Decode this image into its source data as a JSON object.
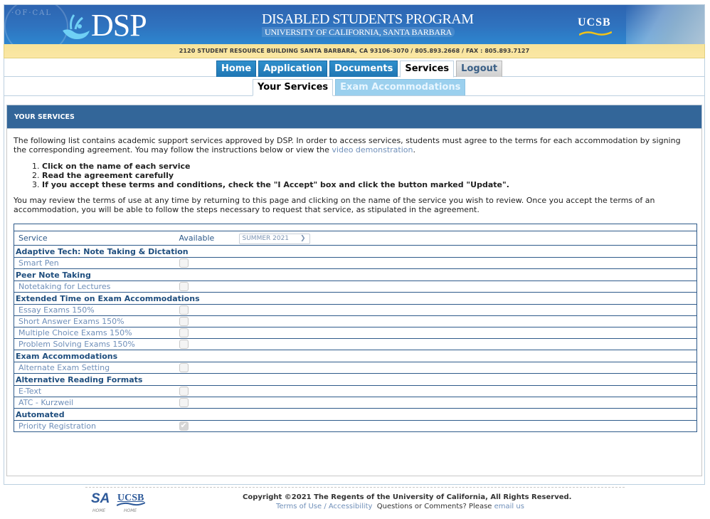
{
  "header": {
    "seal_text": "·OF·CAL",
    "logo": "DSP",
    "program_title": "DISABLED STUDENTS PROGRAM",
    "program_subtitle": "UNIVERSITY OF CALIFORNIA, SANTA BARBARA",
    "ucsb_logo": "UCSB",
    "address": "2120 STUDENT RESOURCE BUILDING SANTA BARBARA, CA 93106-3070 / 805.893.2668 / FAX : 805.893.7127",
    "brand_color": "#2f6fba",
    "address_bar_color": "#fbe7a4"
  },
  "nav": {
    "tabs": [
      {
        "label": "Home",
        "active": false
      },
      {
        "label": "Application",
        "active": false
      },
      {
        "label": "Documents",
        "active": false
      },
      {
        "label": "Services",
        "active": true
      },
      {
        "label": "Logout",
        "active": false
      }
    ]
  },
  "subnav": {
    "tabs": [
      {
        "label": "Your Services",
        "active": true
      },
      {
        "label": "Exam Accommodations",
        "active": false
      }
    ]
  },
  "section": {
    "title": "YOUR SERVICES",
    "header_color": "#336699",
    "intro_part1": "The following list contains academic support services approved by DSP. In order to access services, students must agree to the terms for each accommodation by signing the corresponding agreement. You may follow the instructions below or view the ",
    "intro_link": "video demonstration",
    "intro_part2": ".",
    "steps": [
      "Click on the name of each service",
      "Read the agreement carefully",
      "If you accept these terms and conditions, check the \"I Accept\" box and click the button marked \"Update\"."
    ],
    "review_text": "You may review the terms of use at any time by returning to this page and clicking on the name of the service you wish to review. Once you accept the terms of an accommodation, you will be able to follow the steps necessary to request that service, as stipulated in the agreement."
  },
  "table": {
    "col_service": "Service",
    "col_available": "Available",
    "term_select": "SUMMER 2021",
    "categories": [
      {
        "name": "Adaptive Tech: Note Taking & Dictation",
        "services": [
          {
            "name": "Smart Pen",
            "checked": false
          }
        ]
      },
      {
        "name": "Peer Note Taking",
        "services": [
          {
            "name": "Notetaking for Lectures",
            "checked": false
          }
        ]
      },
      {
        "name": "Extended Time on Exam Accommodations",
        "services": [
          {
            "name": "Essay Exams 150%",
            "checked": false
          },
          {
            "name": "Short Answer Exams 150%",
            "checked": false
          },
          {
            "name": "Multiple Choice Exams 150%",
            "checked": false
          },
          {
            "name": "Problem Solving Exams 150%",
            "checked": false
          }
        ]
      },
      {
        "name": "Exam Accommodations",
        "services": [
          {
            "name": "Alternate Exam Setting",
            "checked": false
          }
        ]
      },
      {
        "name": "Alternative Reading Formats",
        "services": [
          {
            "name": "E-Text",
            "checked": false
          },
          {
            "name": "ATC - Kurzweil",
            "checked": false
          }
        ]
      },
      {
        "name": "Automated",
        "services": [
          {
            "name": "Priority Registration",
            "checked": true
          }
        ]
      }
    ]
  },
  "footer": {
    "sa_logo": "SA",
    "sa_home": "HOME",
    "ucsb_logo": "UCSB",
    "ucsb_home": "HOME",
    "copyright": "Copyright ©2021 The Regents of the University of California, All Rights Reserved.",
    "terms_link": "Terms of Use",
    "separator": " / ",
    "accessibility_link": "Accessibility",
    "questions_text": "  Questions or Comments? Please ",
    "email_link": "email us"
  }
}
